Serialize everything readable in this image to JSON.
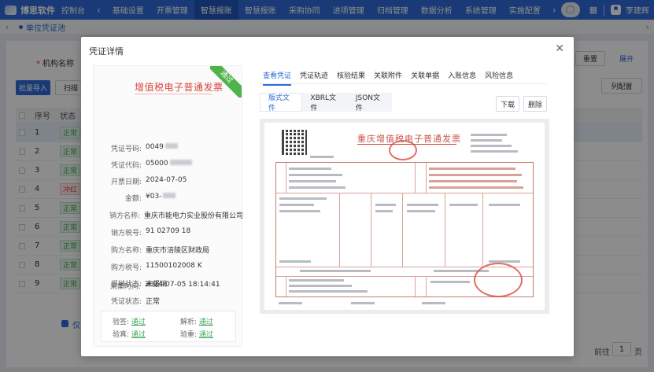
{
  "app": {
    "brand": "博思软件",
    "nav": [
      "控制台",
      "基础设置",
      "开票管理",
      "智慧报账",
      "智慧报账",
      "采购协同",
      "进项管理",
      "归档管理",
      "数据分析",
      "系统管理",
      "实施配置"
    ],
    "active_nav_index": 3,
    "user_name": "李建辉",
    "colors": {
      "primary": "#2f6bd8",
      "success": "#3aa655",
      "danger": "#e2483e",
      "invoice_red": "#c8574b"
    }
  },
  "tabs": {
    "current": "单位凭证池"
  },
  "list": {
    "filter_label": "机构名称",
    "reset": "重置",
    "expand": "展开",
    "batch_import": "批量导入",
    "scan": "扫描",
    "columns_config": "列配置",
    "headers": {
      "no": "序号",
      "status": "状态"
    },
    "rows": [
      {
        "no": "1",
        "status": "正常",
        "red": false
      },
      {
        "no": "2",
        "status": "正常",
        "red": false
      },
      {
        "no": "3",
        "status": "正常",
        "red": false
      },
      {
        "no": "4",
        "status": "冲红",
        "red": true
      },
      {
        "no": "5",
        "status": "正常",
        "red": false
      },
      {
        "no": "6",
        "status": "正常",
        "red": false
      },
      {
        "no": "7",
        "status": "正常",
        "red": false
      },
      {
        "no": "8",
        "status": "正常",
        "red": false
      },
      {
        "no": "9",
        "status": "正常",
        "red": false
      }
    ],
    "footer_partial": "仅",
    "pager_prefix": "前往",
    "pager_value": "1",
    "pager_suffix": "页"
  },
  "modal": {
    "title": "凭证详情",
    "close_icon": "close-icon",
    "card": {
      "ribbon": "通过",
      "title": "增值税电子普通发票",
      "fields": [
        {
          "label": "凭证号码:",
          "value": "0049"
        },
        {
          "label": "凭证代码:",
          "value": "05000"
        },
        {
          "label": "开票日期:",
          "value": "2024-07-05"
        },
        {
          "label": "金额:",
          "value": "¥03-"
        },
        {
          "label": "销方名称:",
          "value": "重庆市能电力实业股份有限公司"
        },
        {
          "label": "销方税号:",
          "value": "91 02709 18"
        },
        {
          "label": "购方名称:",
          "value": "重庆市涪陵区财政局"
        },
        {
          "label": "购方税号:",
          "value": "11500102008 K"
        },
        {
          "label": "报销状态:",
          "value": "未报销"
        },
        {
          "label": "凭证状态:",
          "value": "正常"
        },
        {
          "label": "采集时间:",
          "value": "2024-07-05 18:14:41"
        }
      ],
      "checks": [
        {
          "label": "验签:",
          "value": "通过"
        },
        {
          "label": "解析:",
          "value": "通过"
        },
        {
          "label": "验真:",
          "value": "通过"
        },
        {
          "label": "验重:",
          "value": "通过"
        }
      ]
    },
    "tabs": [
      "查看凭证",
      "凭证轨迹",
      "核验结果",
      "关联附件",
      "关联单据",
      "入账信息",
      "风险信息"
    ],
    "active_tab_index": 0,
    "formats": [
      "版式文件",
      "XBRL文件",
      "JSON文件"
    ],
    "active_format_index": 0,
    "download": "下载",
    "delete": "删除",
    "invoice_title": "重庆增值税电子普通发票"
  }
}
